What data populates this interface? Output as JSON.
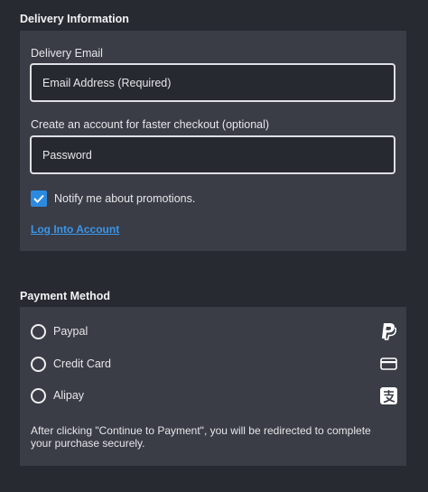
{
  "delivery": {
    "title": "Delivery Information",
    "email_label": "Delivery Email",
    "email_placeholder": "Email Address (Required)",
    "password_label": "Create an account for faster checkout (optional)",
    "password_placeholder": "Password",
    "promo_checkbox_label": "Notify me about promotions.",
    "promo_checked": true,
    "login_link": "Log Into Account"
  },
  "payment": {
    "title": "Payment Method",
    "options": [
      {
        "label": "Paypal",
        "icon": "paypal-icon"
      },
      {
        "label": "Credit Card",
        "icon": "credit-card-icon"
      },
      {
        "label": "Alipay",
        "icon": "alipay-icon"
      }
    ],
    "note": "After clicking \"Continue to Payment\", you will be redirected to complete your purchase securely."
  },
  "colors": {
    "background": "#272a31",
    "panel": "#3a3d46",
    "accent": "#2b8ae0",
    "link": "#3a96ea"
  }
}
